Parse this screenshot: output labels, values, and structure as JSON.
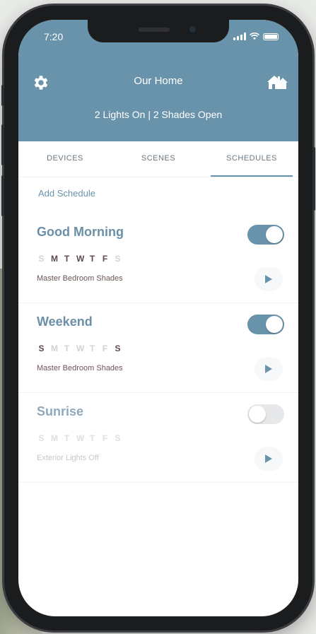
{
  "status_bar": {
    "time": "7:20"
  },
  "header": {
    "title": "Our Home",
    "summary": "2 Lights On  |  2 Shades Open"
  },
  "tabs": [
    {
      "label": "DEVICES",
      "active": false
    },
    {
      "label": "SCENES",
      "active": false
    },
    {
      "label": "SCHEDULES",
      "active": true
    }
  ],
  "add_schedule_label": "Add Schedule",
  "schedules": [
    {
      "name": "Good Morning",
      "enabled": true,
      "days": [
        {
          "letter": "S",
          "on": false
        },
        {
          "letter": "M",
          "on": true
        },
        {
          "letter": "T",
          "on": true
        },
        {
          "letter": "W",
          "on": true
        },
        {
          "letter": "T",
          "on": true
        },
        {
          "letter": "F",
          "on": true
        },
        {
          "letter": "S",
          "on": false
        }
      ],
      "target": "Master Bedroom Shades"
    },
    {
      "name": "Weekend",
      "enabled": true,
      "days": [
        {
          "letter": "S",
          "on": true
        },
        {
          "letter": "M",
          "on": false
        },
        {
          "letter": "T",
          "on": false
        },
        {
          "letter": "W",
          "on": false
        },
        {
          "letter": "T",
          "on": false
        },
        {
          "letter": "F",
          "on": false
        },
        {
          "letter": "S",
          "on": true
        }
      ],
      "target": "Master Bedroom Shades"
    },
    {
      "name": "Sunrise",
      "enabled": false,
      "days": [
        {
          "letter": "S",
          "on": false
        },
        {
          "letter": "M",
          "on": false
        },
        {
          "letter": "T",
          "on": false
        },
        {
          "letter": "W",
          "on": false
        },
        {
          "letter": "T",
          "on": false
        },
        {
          "letter": "F",
          "on": false
        },
        {
          "letter": "S",
          "on": false
        }
      ],
      "target": "Exterior Lights Off"
    }
  ],
  "colors": {
    "header_bg": "#6993ab",
    "accent": "#6993ab",
    "day_on": "#5e4a48",
    "day_off": "#cfd3d7"
  },
  "icons": {
    "settings": "gear-icon",
    "home": "home-icon",
    "play": "play-icon"
  }
}
